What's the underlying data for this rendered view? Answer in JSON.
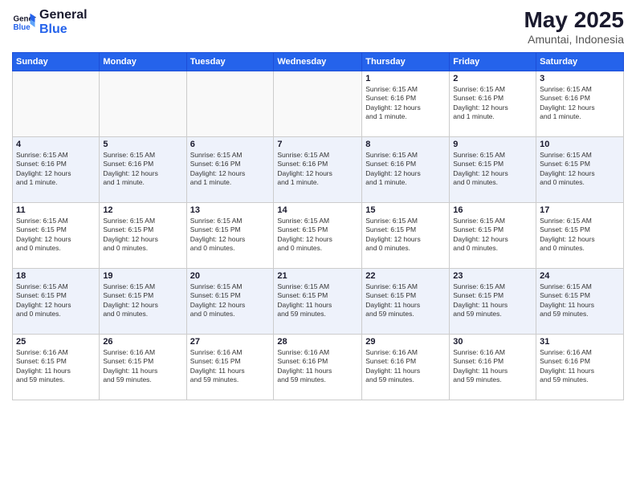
{
  "logo": {
    "text_general": "General",
    "text_blue": "Blue"
  },
  "header": {
    "month_year": "May 2025",
    "location": "Amuntai, Indonesia"
  },
  "days_of_week": [
    "Sunday",
    "Monday",
    "Tuesday",
    "Wednesday",
    "Thursday",
    "Friday",
    "Saturday"
  ],
  "weeks": [
    {
      "row_alt": false,
      "days": [
        {
          "num": "",
          "empty": true,
          "info": ""
        },
        {
          "num": "",
          "empty": true,
          "info": ""
        },
        {
          "num": "",
          "empty": true,
          "info": ""
        },
        {
          "num": "",
          "empty": true,
          "info": ""
        },
        {
          "num": "1",
          "empty": false,
          "info": "Sunrise: 6:15 AM\nSunset: 6:16 PM\nDaylight: 12 hours\nand 1 minute."
        },
        {
          "num": "2",
          "empty": false,
          "info": "Sunrise: 6:15 AM\nSunset: 6:16 PM\nDaylight: 12 hours\nand 1 minute."
        },
        {
          "num": "3",
          "empty": false,
          "info": "Sunrise: 6:15 AM\nSunset: 6:16 PM\nDaylight: 12 hours\nand 1 minute."
        }
      ]
    },
    {
      "row_alt": true,
      "days": [
        {
          "num": "4",
          "empty": false,
          "info": "Sunrise: 6:15 AM\nSunset: 6:16 PM\nDaylight: 12 hours\nand 1 minute."
        },
        {
          "num": "5",
          "empty": false,
          "info": "Sunrise: 6:15 AM\nSunset: 6:16 PM\nDaylight: 12 hours\nand 1 minute."
        },
        {
          "num": "6",
          "empty": false,
          "info": "Sunrise: 6:15 AM\nSunset: 6:16 PM\nDaylight: 12 hours\nand 1 minute."
        },
        {
          "num": "7",
          "empty": false,
          "info": "Sunrise: 6:15 AM\nSunset: 6:16 PM\nDaylight: 12 hours\nand 1 minute."
        },
        {
          "num": "8",
          "empty": false,
          "info": "Sunrise: 6:15 AM\nSunset: 6:16 PM\nDaylight: 12 hours\nand 1 minute."
        },
        {
          "num": "9",
          "empty": false,
          "info": "Sunrise: 6:15 AM\nSunset: 6:15 PM\nDaylight: 12 hours\nand 0 minutes."
        },
        {
          "num": "10",
          "empty": false,
          "info": "Sunrise: 6:15 AM\nSunset: 6:15 PM\nDaylight: 12 hours\nand 0 minutes."
        }
      ]
    },
    {
      "row_alt": false,
      "days": [
        {
          "num": "11",
          "empty": false,
          "info": "Sunrise: 6:15 AM\nSunset: 6:15 PM\nDaylight: 12 hours\nand 0 minutes."
        },
        {
          "num": "12",
          "empty": false,
          "info": "Sunrise: 6:15 AM\nSunset: 6:15 PM\nDaylight: 12 hours\nand 0 minutes."
        },
        {
          "num": "13",
          "empty": false,
          "info": "Sunrise: 6:15 AM\nSunset: 6:15 PM\nDaylight: 12 hours\nand 0 minutes."
        },
        {
          "num": "14",
          "empty": false,
          "info": "Sunrise: 6:15 AM\nSunset: 6:15 PM\nDaylight: 12 hours\nand 0 minutes."
        },
        {
          "num": "15",
          "empty": false,
          "info": "Sunrise: 6:15 AM\nSunset: 6:15 PM\nDaylight: 12 hours\nand 0 minutes."
        },
        {
          "num": "16",
          "empty": false,
          "info": "Sunrise: 6:15 AM\nSunset: 6:15 PM\nDaylight: 12 hours\nand 0 minutes."
        },
        {
          "num": "17",
          "empty": false,
          "info": "Sunrise: 6:15 AM\nSunset: 6:15 PM\nDaylight: 12 hours\nand 0 minutes."
        }
      ]
    },
    {
      "row_alt": true,
      "days": [
        {
          "num": "18",
          "empty": false,
          "info": "Sunrise: 6:15 AM\nSunset: 6:15 PM\nDaylight: 12 hours\nand 0 minutes."
        },
        {
          "num": "19",
          "empty": false,
          "info": "Sunrise: 6:15 AM\nSunset: 6:15 PM\nDaylight: 12 hours\nand 0 minutes."
        },
        {
          "num": "20",
          "empty": false,
          "info": "Sunrise: 6:15 AM\nSunset: 6:15 PM\nDaylight: 12 hours\nand 0 minutes."
        },
        {
          "num": "21",
          "empty": false,
          "info": "Sunrise: 6:15 AM\nSunset: 6:15 PM\nDaylight: 11 hours\nand 59 minutes."
        },
        {
          "num": "22",
          "empty": false,
          "info": "Sunrise: 6:15 AM\nSunset: 6:15 PM\nDaylight: 11 hours\nand 59 minutes."
        },
        {
          "num": "23",
          "empty": false,
          "info": "Sunrise: 6:15 AM\nSunset: 6:15 PM\nDaylight: 11 hours\nand 59 minutes."
        },
        {
          "num": "24",
          "empty": false,
          "info": "Sunrise: 6:15 AM\nSunset: 6:15 PM\nDaylight: 11 hours\nand 59 minutes."
        }
      ]
    },
    {
      "row_alt": false,
      "days": [
        {
          "num": "25",
          "empty": false,
          "info": "Sunrise: 6:16 AM\nSunset: 6:15 PM\nDaylight: 11 hours\nand 59 minutes."
        },
        {
          "num": "26",
          "empty": false,
          "info": "Sunrise: 6:16 AM\nSunset: 6:15 PM\nDaylight: 11 hours\nand 59 minutes."
        },
        {
          "num": "27",
          "empty": false,
          "info": "Sunrise: 6:16 AM\nSunset: 6:15 PM\nDaylight: 11 hours\nand 59 minutes."
        },
        {
          "num": "28",
          "empty": false,
          "info": "Sunrise: 6:16 AM\nSunset: 6:16 PM\nDaylight: 11 hours\nand 59 minutes."
        },
        {
          "num": "29",
          "empty": false,
          "info": "Sunrise: 6:16 AM\nSunset: 6:16 PM\nDaylight: 11 hours\nand 59 minutes."
        },
        {
          "num": "30",
          "empty": false,
          "info": "Sunrise: 6:16 AM\nSunset: 6:16 PM\nDaylight: 11 hours\nand 59 minutes."
        },
        {
          "num": "31",
          "empty": false,
          "info": "Sunrise: 6:16 AM\nSunset: 6:16 PM\nDaylight: 11 hours\nand 59 minutes."
        }
      ]
    }
  ]
}
